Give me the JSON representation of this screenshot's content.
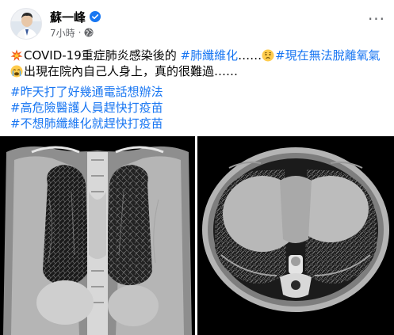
{
  "author": {
    "name": "蘇一峰",
    "verified_icon": "verified-badge-icon",
    "time": "7小時",
    "dot": "·",
    "privacy_icon": "globe-icon"
  },
  "more_menu": {
    "label": "···",
    "icon": "more-options-icon"
  },
  "post": {
    "line1": {
      "emoji": "explosion-emoji",
      "text": "COVID-19重症肺炎感染後的 ",
      "tag1": "#肺纖維化",
      "text2": "……",
      "emoji2": "worried-face-emoji",
      "tag2": "#現在無法脫離氧氣"
    },
    "line2": {
      "emoji": "crying-face-emoji",
      "text": "出現在院內自己人身上，真的很難過……"
    },
    "hashtags": [
      "#昨天打了好幾通電話想辦法",
      "#高危險醫護人員趕快打疫苗",
      "#不想肺纖維化就趕快打疫苗"
    ]
  },
  "media": {
    "left_image": "coronal-chest-ct-scan",
    "right_image": "axial-chest-ct-scan"
  },
  "colors": {
    "hashtag": "#1876f2",
    "meta": "#65676b",
    "text": "#050505",
    "verified": "#1877f2"
  }
}
